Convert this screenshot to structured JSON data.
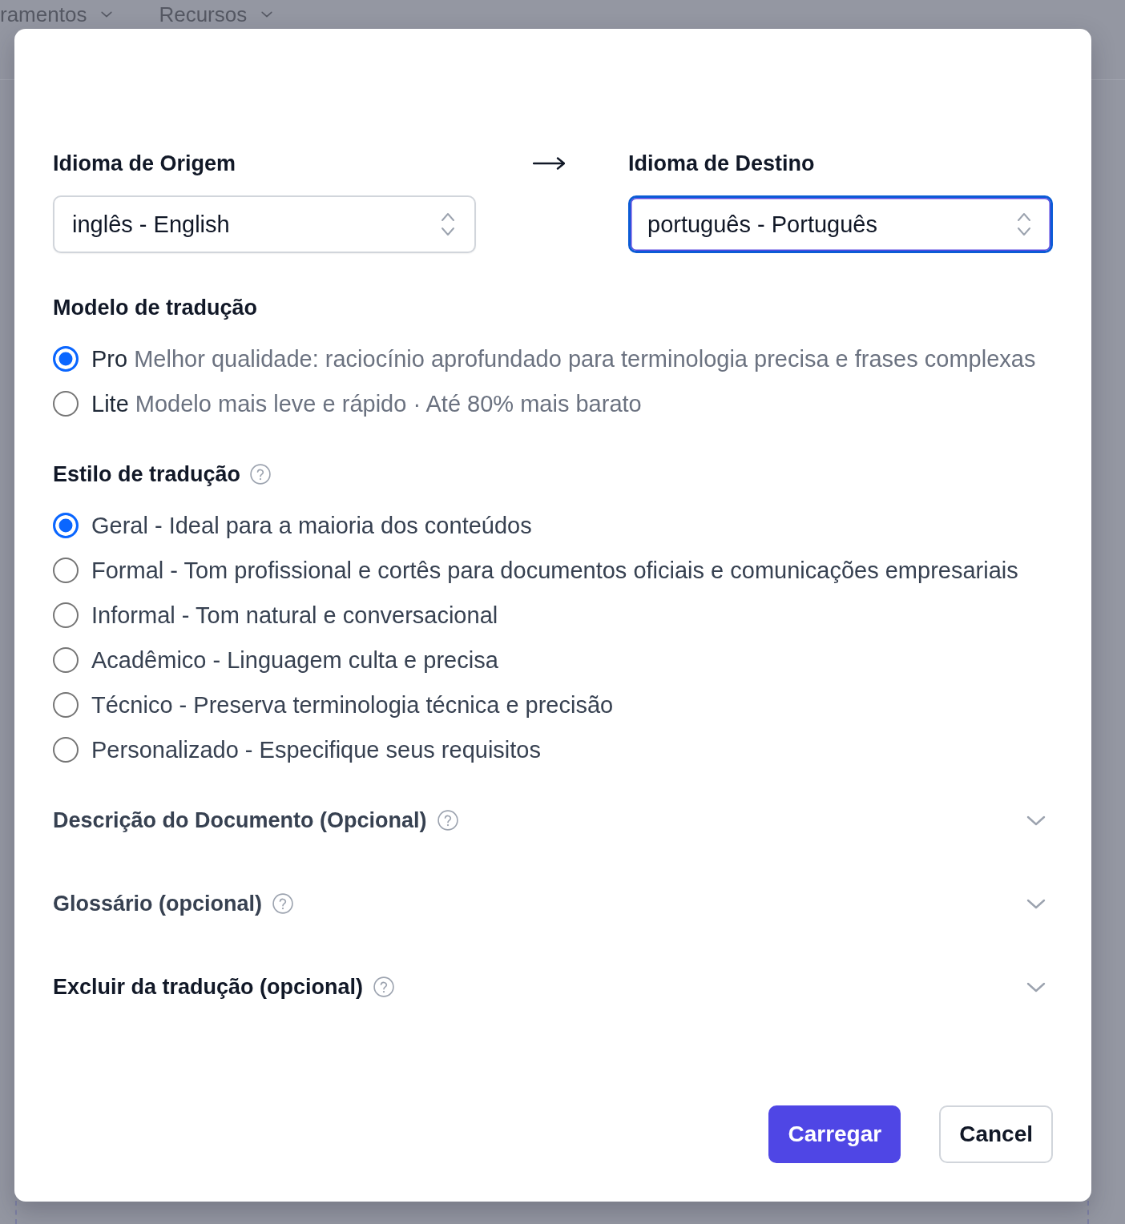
{
  "background": {
    "nav": [
      {
        "label": "ramentos"
      },
      {
        "label": "Recursos"
      }
    ]
  },
  "source": {
    "label": "Idioma de Origem",
    "value": "inglês - English",
    "focused": false
  },
  "target": {
    "label": "Idioma de Destino",
    "value": "português - Português",
    "focused": true
  },
  "model": {
    "title": "Modelo de tradução",
    "options": [
      {
        "name": "Pro",
        "description": "Melhor qualidade: raciocínio aprofundado para terminologia precisa e frases complexas",
        "selected": true
      },
      {
        "name": "Lite",
        "description": "Modelo mais leve e rápido · Até 80% mais barato",
        "selected": false
      }
    ]
  },
  "style": {
    "title": "Estilo de tradução",
    "options": [
      {
        "label": "Geral - Ideal para a maioria dos conteúdos",
        "selected": true
      },
      {
        "label": "Formal - Tom profissional e cortês para documentos oficiais e comunicações empresariais",
        "selected": false
      },
      {
        "label": "Informal - Tom natural e conversacional",
        "selected": false
      },
      {
        "label": "Acadêmico - Linguagem culta e precisa",
        "selected": false
      },
      {
        "label": "Técnico - Preserva terminologia técnica e precisão",
        "selected": false
      },
      {
        "label": "Personalizado - Especifique seus requisitos",
        "selected": false
      }
    ]
  },
  "sections": [
    {
      "title": "Descrição do Documento (Opcional)",
      "expanded": false,
      "hovered": false
    },
    {
      "title": "Glossário (opcional)",
      "expanded": false,
      "hovered": false
    },
    {
      "title": "Excluir da tradução (opcional)",
      "expanded": false,
      "hovered": true
    }
  ],
  "buttons": [
    {
      "label": "Carregar",
      "kind": "primary"
    },
    {
      "label": "Cancel",
      "kind": "secondary"
    }
  ]
}
